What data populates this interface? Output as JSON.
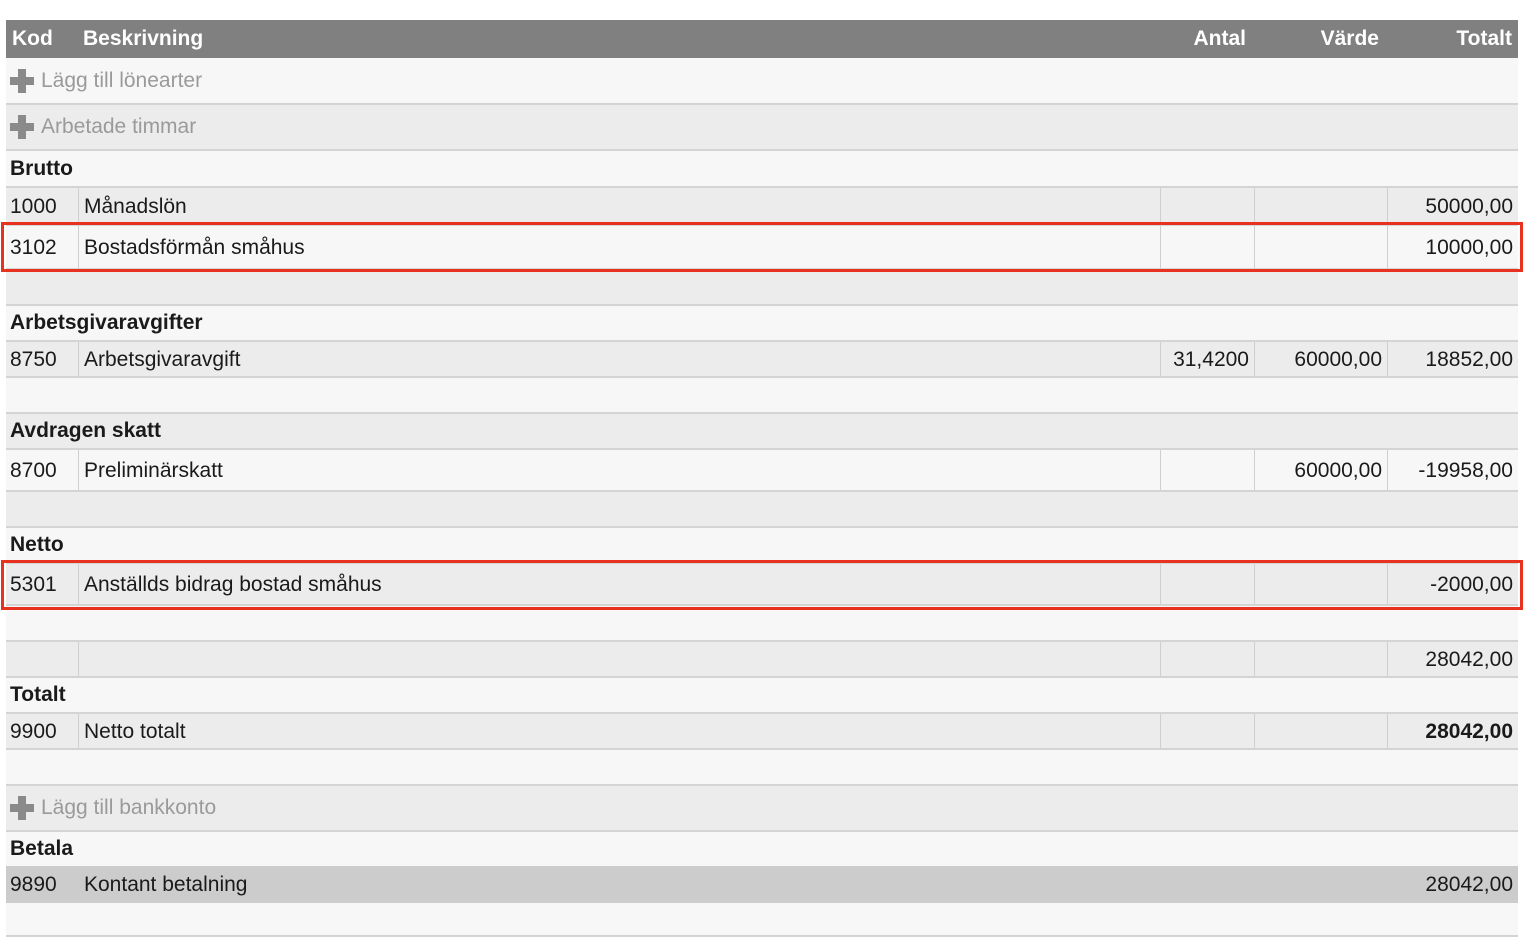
{
  "columns": {
    "kod": "Kod",
    "beskrivning": "Beskrivning",
    "antal": "Antal",
    "varde": "Värde",
    "totalt": "Totalt"
  },
  "actions": {
    "add_salary_types": "Lägg till lönearter",
    "worked_hours": "Arbetade timmar",
    "add_bank_account": "Lägg till bankkonto"
  },
  "sections": {
    "brutto": "Brutto",
    "arbetsgivaravgifter": "Arbetsgivaravgifter",
    "avdragen_skatt": "Avdragen skatt",
    "netto": "Netto",
    "totalt": "Totalt",
    "betala": "Betala"
  },
  "rows": [
    {
      "kod": "1000",
      "beskrivning": "Månadslön",
      "antal": "",
      "varde": "",
      "totalt": "50000,00"
    },
    {
      "kod": "3102",
      "beskrivning": "Bostadsförmån småhus",
      "antal": "",
      "varde": "",
      "totalt": "10000,00"
    },
    {
      "kod": "8750",
      "beskrivning": "Arbetsgivaravgift",
      "antal": "31,4200",
      "varde": "60000,00",
      "totalt": "18852,00"
    },
    {
      "kod": "8700",
      "beskrivning": "Preliminärskatt",
      "antal": "",
      "varde": "60000,00",
      "totalt": "-19958,00"
    },
    {
      "kod": "5301",
      "beskrivning": "Anställds bidrag bostad småhus",
      "antal": "",
      "varde": "",
      "totalt": "-2000,00"
    },
    {
      "kod": "",
      "beskrivning": "",
      "antal": "",
      "varde": "",
      "totalt": "28042,00"
    },
    {
      "kod": "9900",
      "beskrivning": "Netto totalt",
      "antal": "",
      "varde": "",
      "totalt": "28042,00"
    },
    {
      "kod": "9890",
      "beskrivning": "Kontant betalning",
      "antal": "",
      "varde": "",
      "totalt": "28042,00"
    }
  ],
  "highlight_color": "#e8311f"
}
